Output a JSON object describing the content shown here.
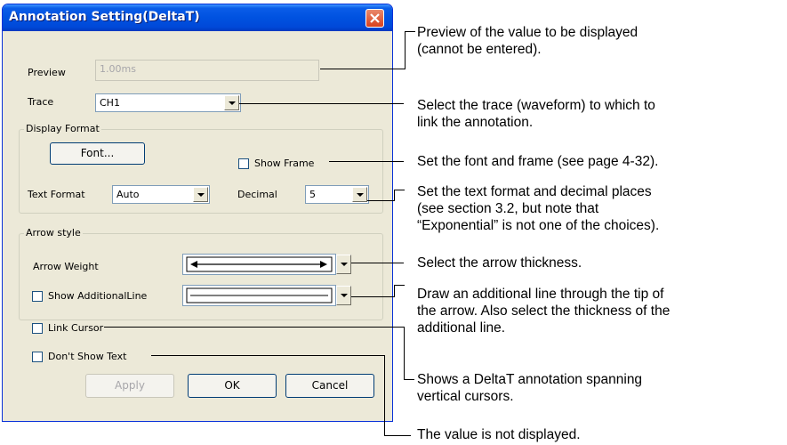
{
  "dialog": {
    "title": "Annotation Setting(DeltaT)",
    "preview_label": "Preview",
    "preview_value": "1.00ms",
    "trace_label": "Trace",
    "trace_value": "CH1",
    "display_format": {
      "legend": "Display Format",
      "font_button": "Font...",
      "show_frame_label": "Show Frame",
      "text_format_label": "Text Format",
      "text_format_value": "Auto",
      "decimal_label": "Decimal",
      "decimal_value": "5"
    },
    "arrow_style": {
      "legend": "Arrow style",
      "arrow_weight_label": "Arrow Weight",
      "show_additional_line_label": "Show AdditionalLine"
    },
    "link_cursor_label": "Link Cursor",
    "dont_show_text_label": "Don't Show Text",
    "buttons": {
      "apply": "Apply",
      "ok": "OK",
      "cancel": "Cancel"
    }
  },
  "annotations": {
    "preview": [
      "Preview of the value to be displayed",
      "(cannot be entered)."
    ],
    "trace": [
      "Select the trace (waveform) to which to",
      "link the annotation."
    ],
    "font": "Set the font and frame (see page 4-32).",
    "format": [
      "Set the text format and decimal places",
      "(see section 3.2, but note that",
      "“Exponential” is not one of the choices)."
    ],
    "arrow": "Select the arrow thickness.",
    "additional": [
      "Draw an additional line through the tip of",
      "the arrow. Also select the thickness of the",
      "additional line."
    ],
    "link": [
      "Shows a DeltaT annotation spanning",
      "vertical cursors."
    ],
    "notext": "The value is not displayed."
  }
}
